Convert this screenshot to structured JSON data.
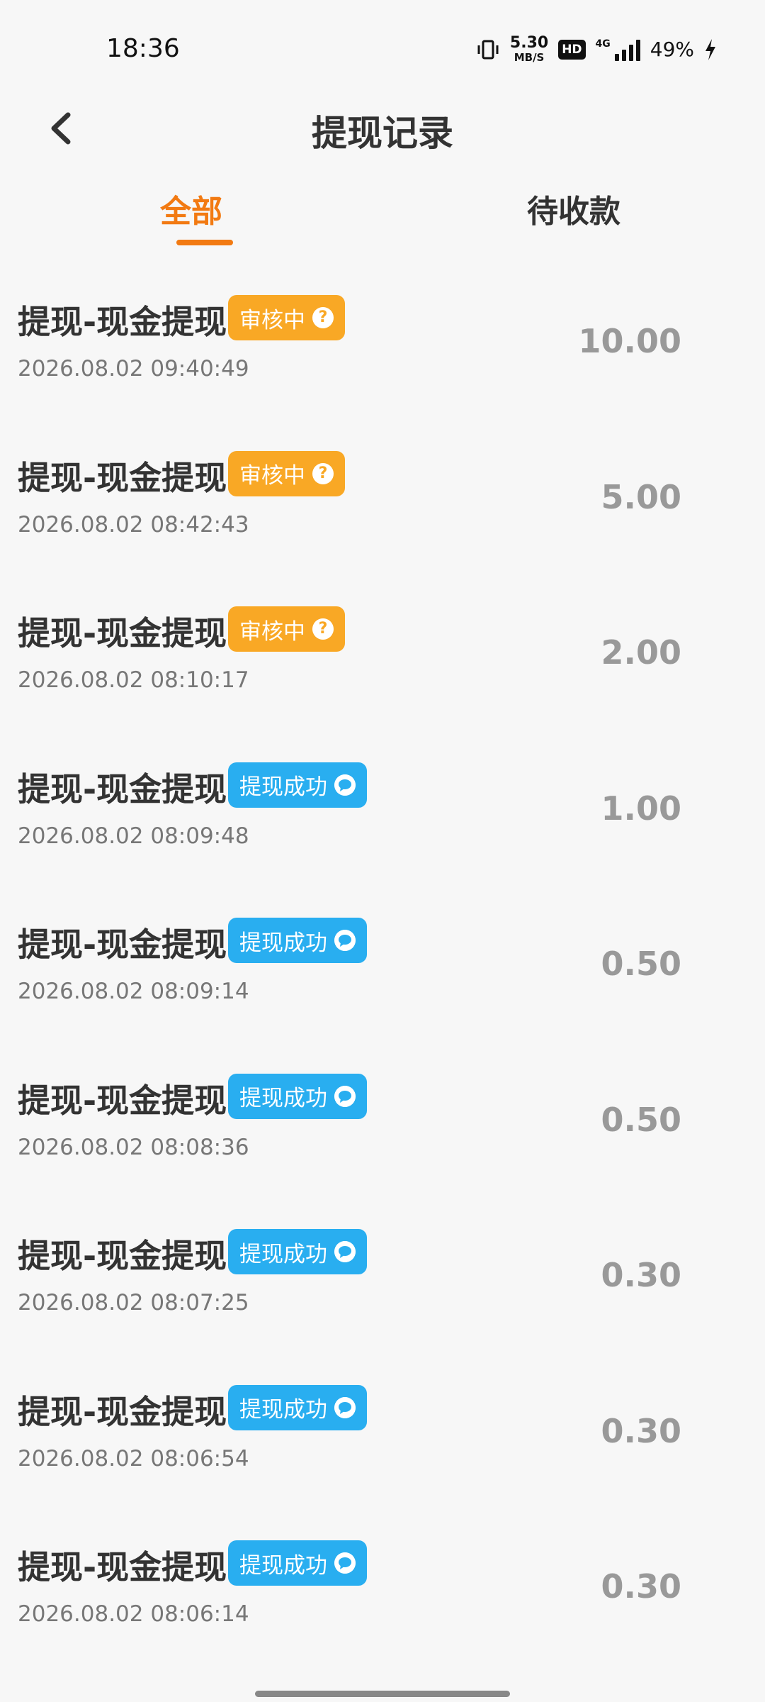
{
  "status_bar": {
    "time": "18:36",
    "net_speed_value": "5.30",
    "net_speed_unit": "MB/S",
    "hd_label": "HD",
    "signal_label": "4G",
    "battery": "49%"
  },
  "header": {
    "title": "提现记录",
    "back_icon": "chevron-left-icon"
  },
  "tabs": [
    {
      "label": "全部",
      "active": true
    },
    {
      "label": "待收款",
      "active": false
    }
  ],
  "colors": {
    "accent": "#f27a12",
    "review_badge": "#f9a825",
    "success_badge": "#29aef0",
    "amount": "#999999"
  },
  "records": [
    {
      "title": "提现-现金提现",
      "status": "审核中",
      "status_icon": "question-icon",
      "time": "2026.08.02 09:40:49",
      "amount": "10.00"
    },
    {
      "title": "提现-现金提现",
      "status": "审核中",
      "status_icon": "question-icon",
      "time": "2026.08.02 08:42:43",
      "amount": "5.00"
    },
    {
      "title": "提现-现金提现",
      "status": "审核中",
      "status_icon": "question-icon",
      "time": "2026.08.02 08:10:17",
      "amount": "2.00"
    },
    {
      "title": "提现-现金提现",
      "status": "提现成功",
      "status_icon": "wechat-icon",
      "time": "2026.08.02 08:09:48",
      "amount": "1.00"
    },
    {
      "title": "提现-现金提现",
      "status": "提现成功",
      "status_icon": "wechat-icon",
      "time": "2026.08.02 08:09:14",
      "amount": "0.50"
    },
    {
      "title": "提现-现金提现",
      "status": "提现成功",
      "status_icon": "wechat-icon",
      "time": "2026.08.02 08:08:36",
      "amount": "0.50"
    },
    {
      "title": "提现-现金提现",
      "status": "提现成功",
      "status_icon": "wechat-icon",
      "time": "2026.08.02 08:07:25",
      "amount": "0.30"
    },
    {
      "title": "提现-现金提现",
      "status": "提现成功",
      "status_icon": "wechat-icon",
      "time": "2026.08.02 08:06:54",
      "amount": "0.30"
    },
    {
      "title": "提现-现金提现",
      "status": "提现成功",
      "status_icon": "wechat-icon",
      "time": "2026.08.02 08:06:14",
      "amount": "0.30"
    }
  ]
}
